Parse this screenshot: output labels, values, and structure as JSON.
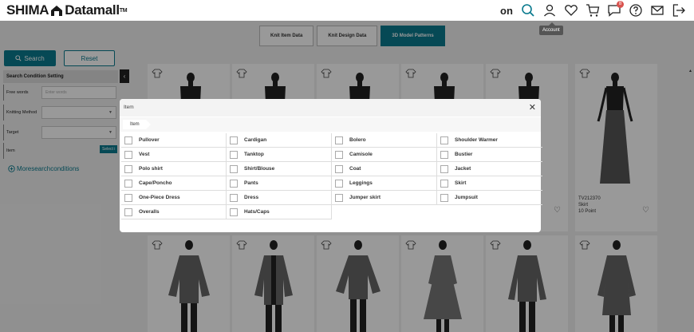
{
  "header": {
    "brand_main": "SHIMA",
    "brand_rest": "Datamall",
    "brand_tm": "TM",
    "on_label": "on",
    "notification_count": "8",
    "account_tooltip": "Account"
  },
  "tabs": [
    {
      "label": "Knit Item Data",
      "active": false
    },
    {
      "label": "Knit Design Data",
      "active": false
    },
    {
      "label": "3D Model Patterns",
      "active": true
    }
  ],
  "sidebar": {
    "search_label": "Search",
    "reset_label": "Reset",
    "heading": "Search Condition Setting",
    "free_words_label": "Free words",
    "free_words_placeholder": "Enter words",
    "knitting_method_label": "Knitting Method",
    "target_label": "Target",
    "item_label": "Item",
    "select_label": "Select i",
    "more_label": "Moresearchconditions"
  },
  "visible_card": {
    "code": "TV212370",
    "type": "Skirt",
    "points": "10 Point"
  },
  "modal": {
    "title": "Item",
    "breadcrumb": "Item",
    "items": [
      "Pullover",
      "Cardigan",
      "Bolero",
      "Shoulder Warmer",
      "Vest",
      "Tanktop",
      "Camisole",
      "Bustier",
      "Polo shirt",
      "Shirt/Blouse",
      "Coat",
      "Jacket",
      "Cape/Poncho",
      "Pants",
      "Leggings",
      "Skirt",
      "One-Piece Dress",
      "Dress",
      "Jumper skirt",
      "Jumpsuit",
      "Overalls",
      "Hats/Caps"
    ]
  },
  "colors": {
    "accent": "#0a7a8e",
    "badge": "#d9534f"
  }
}
